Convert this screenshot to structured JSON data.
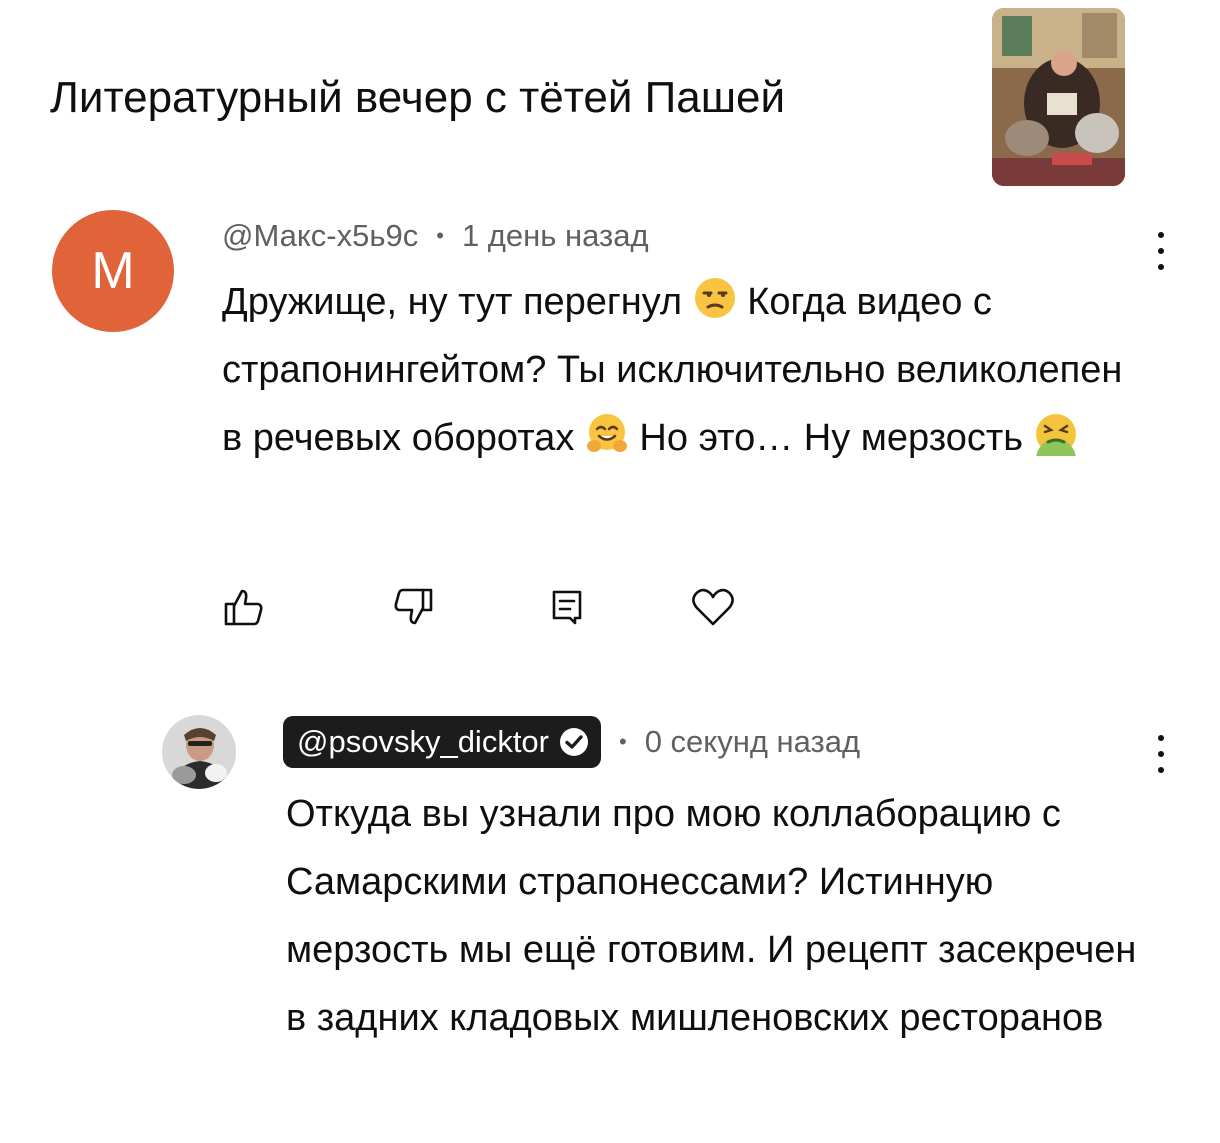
{
  "video": {
    "title": "Литературный вечер с тётей Пашей"
  },
  "comment": {
    "avatar_letter": "M",
    "author": "@Макс-х5ь9с",
    "time": "1 день назад",
    "text_parts": [
      "Дружище, ну тут перегнул ",
      " Когда видео с страпонингейтом? Ты исключительно великолепен в речевых оборотах ",
      " Но это… Ну мерзость "
    ],
    "icons": {
      "like": "thumb-up-icon",
      "dislike": "thumb-down-icon",
      "reply": "reply-icon",
      "heart": "heart-icon",
      "menu": "more-vert-icon"
    }
  },
  "reply": {
    "author": "@psovsky_dicktor",
    "time": "0 секунд назад",
    "text": "Откуда вы узнали про мою коллаборацию с Самарскими страпонессами? Истинную мерзость мы ещё готовим. И рецепт засекречен в задних кладовых мишленовских ресторанов"
  },
  "colors": {
    "avatar_bg": "#e0633a",
    "meta_text": "#606060",
    "chip_bg": "#1c1c1c"
  }
}
